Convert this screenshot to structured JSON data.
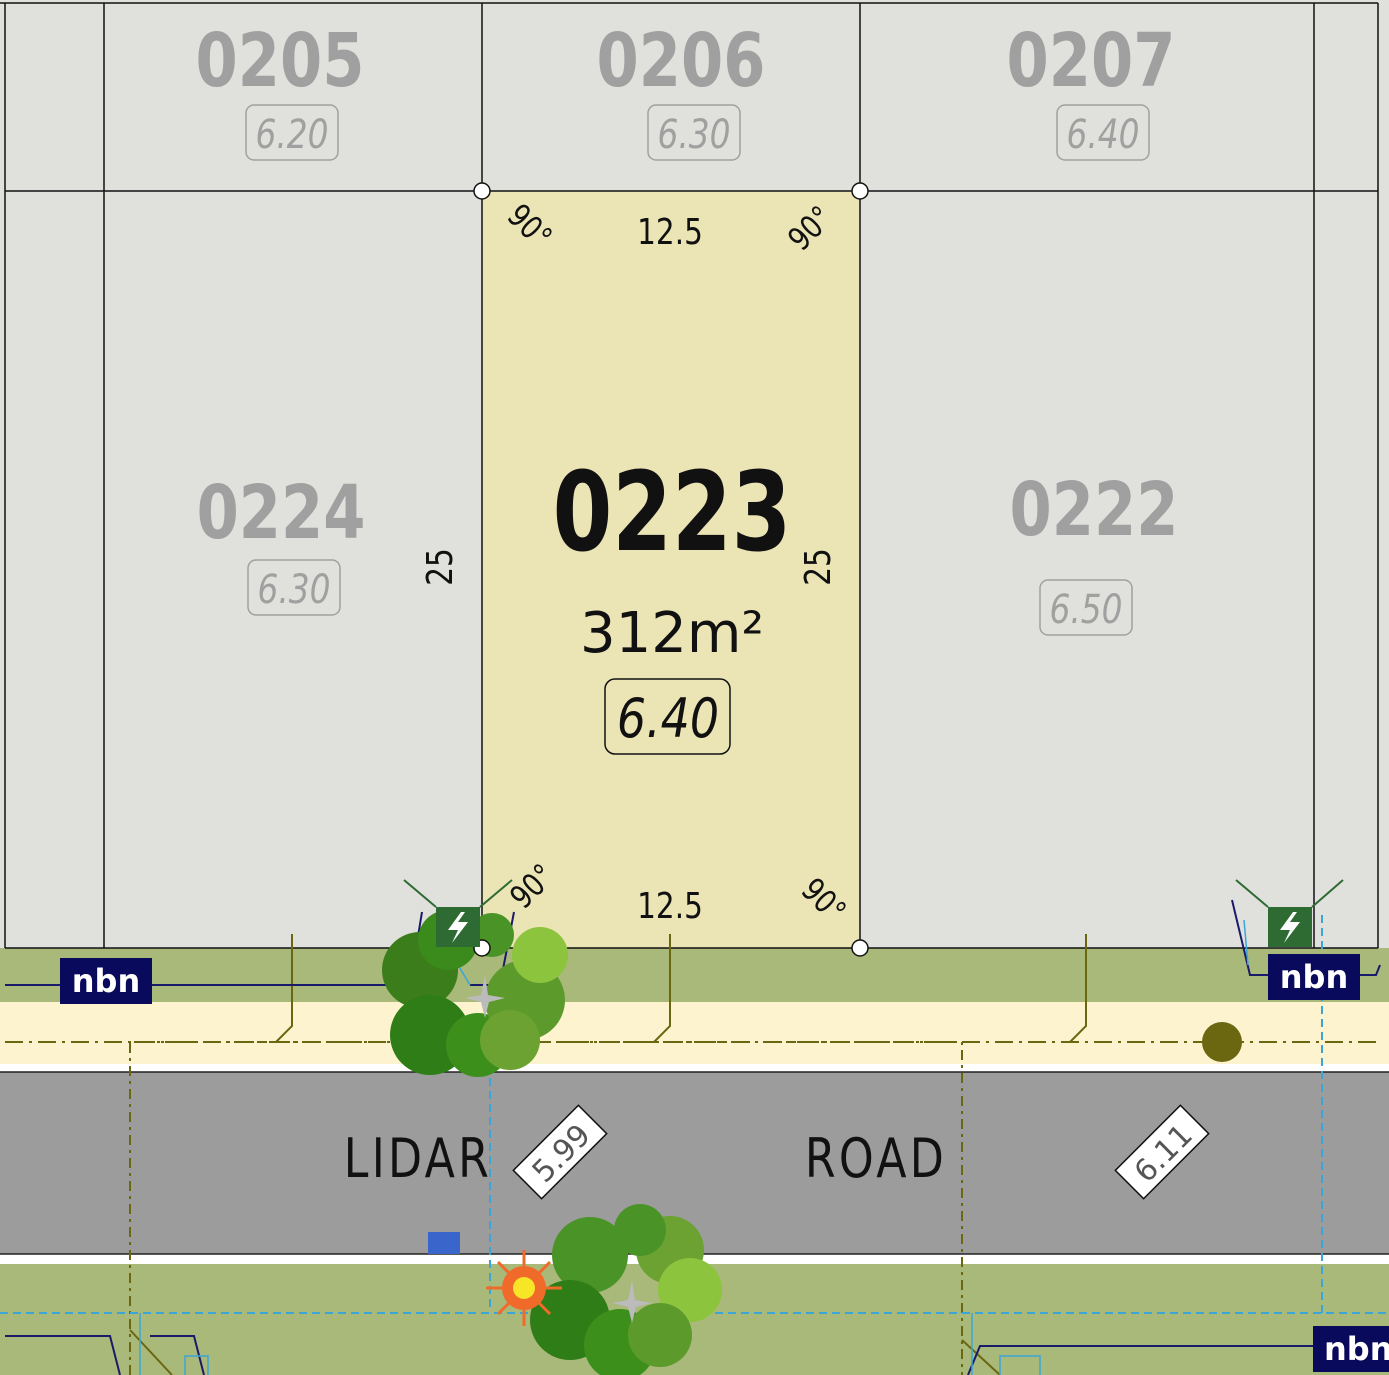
{
  "map": {
    "colors": {
      "lot_neighbor": "#e0e0dd",
      "lot_highlight": "#ebe4b5",
      "verge": "#a8b97a",
      "footpath": "#fdf3cf",
      "road": "#9c9c9c",
      "nbn_badge": "#0a0a5c",
      "power_pit": "#2e6b32",
      "utility_olive": "#6b6610",
      "water_dashed": "#3aa6d8",
      "tree_dark": "#2f7d17",
      "tree_light": "#8cc43d",
      "streetlight": "#f06a2a",
      "hydrant": "#3a66cc"
    },
    "lots": {
      "l0205": {
        "number": "0205",
        "level": "6.20"
      },
      "l0206": {
        "number": "0206",
        "level": "6.30"
      },
      "l0207": {
        "number": "0207",
        "level": "6.40"
      },
      "l0224": {
        "number": "0224",
        "level": "6.30"
      },
      "l0222": {
        "number": "0222",
        "level": "6.50"
      }
    },
    "selected_lot": {
      "number": "0223",
      "area": "312m²",
      "level": "6.40",
      "frontage_top": "12.5",
      "frontage_bottom": "12.5",
      "depth_left": "25",
      "depth_right": "25",
      "angle_tl": "90°",
      "angle_tr": "90°",
      "angle_bl": "90°",
      "angle_br": "90°"
    },
    "road": {
      "name_part1": "LIDAR",
      "name_part2": "ROAD",
      "level_left": "5.99",
      "level_right": "6.11"
    },
    "nbn": {
      "left": "nbn",
      "right": "nbn",
      "bottom": "nbn"
    },
    "icons": {
      "power": "lightning-bolt",
      "tree": "tree-canopy",
      "streetlight": "streetlight",
      "hydrant": "hydrant",
      "sewer": "sewer-manhole"
    }
  }
}
